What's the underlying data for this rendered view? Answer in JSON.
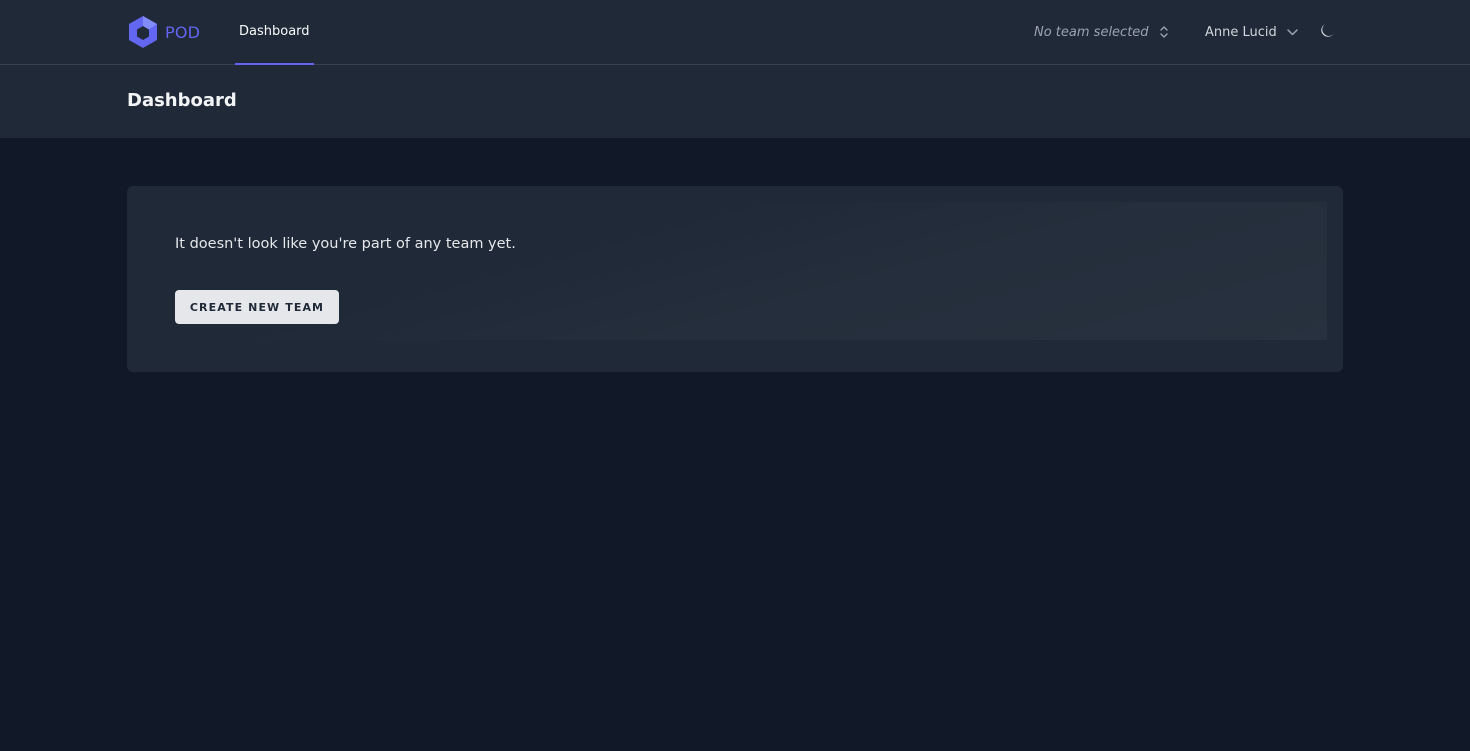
{
  "topnav": {
    "brand": "POD",
    "tabs": [
      {
        "label": "Dashboard",
        "active": true
      }
    ],
    "team_selector": {
      "label": "No team selected"
    },
    "user_menu": {
      "name": "Anne Lucid"
    },
    "theme_toggle_icon": "moon-icon"
  },
  "header": {
    "title": "Dashboard"
  },
  "main": {
    "empty_state": {
      "message": "It doesn't look like you're part of any team yet.",
      "button_label": "CREATE NEW TEAM"
    }
  },
  "colors": {
    "accent": "#6366f1",
    "nav_bg": "#1f2937",
    "page_bg": "#111827",
    "card_bg": "#1f2937",
    "button_bg": "#e5e7eb"
  }
}
